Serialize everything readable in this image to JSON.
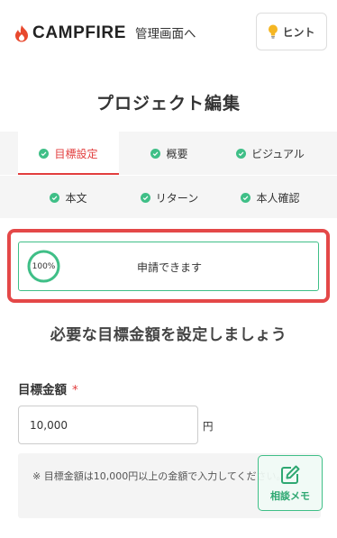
{
  "header": {
    "logo_text": "CAMPFIRE",
    "admin_link": "管理画面へ",
    "hint_label": "ヒント"
  },
  "page_title": "プロジェクト編集",
  "tabs": [
    {
      "label": "目標設定",
      "active": true,
      "completed": true
    },
    {
      "label": "概要",
      "active": false,
      "completed": true
    },
    {
      "label": "ビジュアル",
      "active": false,
      "completed": true
    },
    {
      "label": "本文",
      "active": false,
      "completed": true
    },
    {
      "label": "リターン",
      "active": false,
      "completed": true
    },
    {
      "label": "本人確認",
      "active": false,
      "completed": true
    }
  ],
  "status": {
    "progress_percent": 100,
    "progress_label": "100%",
    "text": "申請できます"
  },
  "section_heading": "必要な目標金額を設定しましょう",
  "goal_field": {
    "label": "目標金額",
    "required_mark": "*",
    "value": "10,000",
    "unit": "円"
  },
  "note": "※ 目標金額は10,000円以上の金額で入力してください。",
  "memo_button": {
    "label": "相談メモ"
  },
  "colors": {
    "brand_red": "#e23d3d",
    "accent_green": "#3fbf87",
    "highlight_red": "#e44848"
  }
}
